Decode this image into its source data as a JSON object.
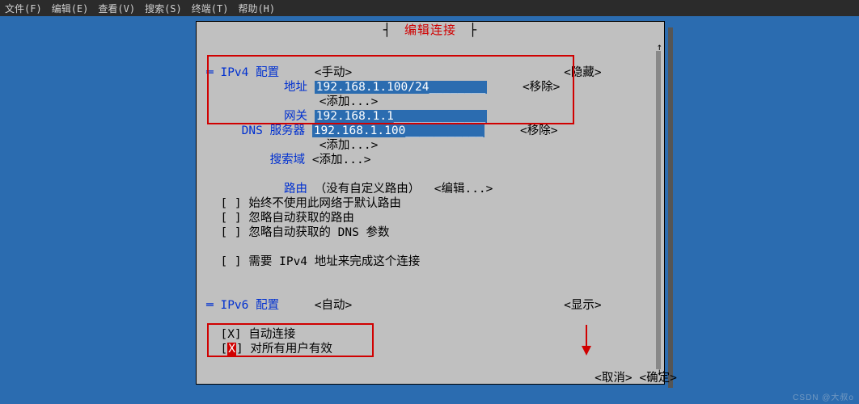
{
  "menubar": {
    "file": "文件(F)",
    "edit": "编辑(E)",
    "view": "查看(V)",
    "search": "搜索(S)",
    "terminal": "终端(T)",
    "help": "帮助(H)"
  },
  "dialog": {
    "title": "编辑连接"
  },
  "ipv4": {
    "section_label": "IPv4 配置",
    "mode": "<手动>",
    "hide": "<隐藏>",
    "addr_label": "地址",
    "addr_value": "192.168.1.100/24________",
    "addr_remove": "<移除>",
    "add1": "<添加...>",
    "gw_label": "网关",
    "gw_value": "192.168.1.1_____________",
    "dns_label": "DNS 服务器",
    "dns_value": "192.168.1.100___________",
    "dns_remove": "<移除>",
    "add2": "<添加...>",
    "search_label": "搜索域",
    "search_add": "<添加...>",
    "route_label": "路由",
    "route_info": "（没有自定义路由）",
    "route_edit": "<编辑...>",
    "cb1": "始终不使用此网络于默认路由",
    "cb2": "忽略自动获取的路由",
    "cb3": "忽略自动获取的 DNS 参数",
    "require": "需要 IPv4 地址来完成这个连接"
  },
  "ipv6": {
    "section_label": "IPv6 配置",
    "mode": "<自动>",
    "show": "<显示>"
  },
  "auto": {
    "cb_auto": "自动连接",
    "cb_all": "对所有用户有效"
  },
  "buttons": {
    "cancel": "<取消>",
    "ok": "<确定>"
  },
  "watermark": "CSDN @大叔o"
}
